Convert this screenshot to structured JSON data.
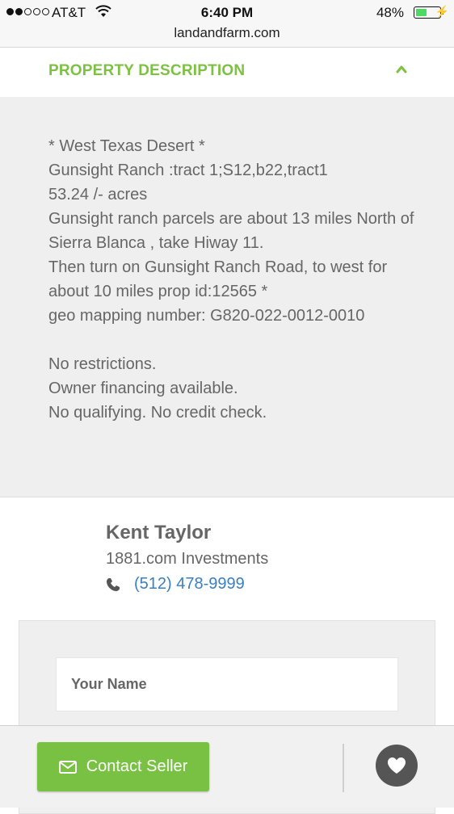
{
  "status_bar": {
    "carrier": "AT&T",
    "time": "6:40 PM",
    "battery_percent": "48%",
    "battery_level": 0.48,
    "url": "landandfarm.com"
  },
  "section": {
    "title": "PROPERTY DESCRIPTION",
    "toggle_icon": "chevron-up-icon"
  },
  "description": {
    "lines": [
      "* West Texas Desert *",
      "Gunsight Ranch :tract 1;S12,b22,tract1",
      "53.24 /- acres",
      "Gunsight ranch parcels are about 13 miles North of Sierra Blanca , take Hiway 11.",
      "Then turn on Gunsight Ranch Road, to west for about 10 miles prop id:12565 *",
      "geo mapping number: G820-022-0012-0010",
      "",
      "No restrictions.",
      "Owner financing available.",
      "No qualifying. No credit check."
    ]
  },
  "seller": {
    "name": "Kent Taylor",
    "company": "1881.com Investments",
    "phone": "(512) 478-9999",
    "phone_icon": "phone-icon"
  },
  "form": {
    "name_placeholder": "Your Name"
  },
  "bottom_bar": {
    "contact_label": "Contact Seller",
    "contact_icon": "mail-icon",
    "favorite_icon": "heart-icon"
  },
  "colors": {
    "accent_green": "#7cc142",
    "link_blue": "#3a7fc1",
    "panel_gray": "#efefef"
  }
}
